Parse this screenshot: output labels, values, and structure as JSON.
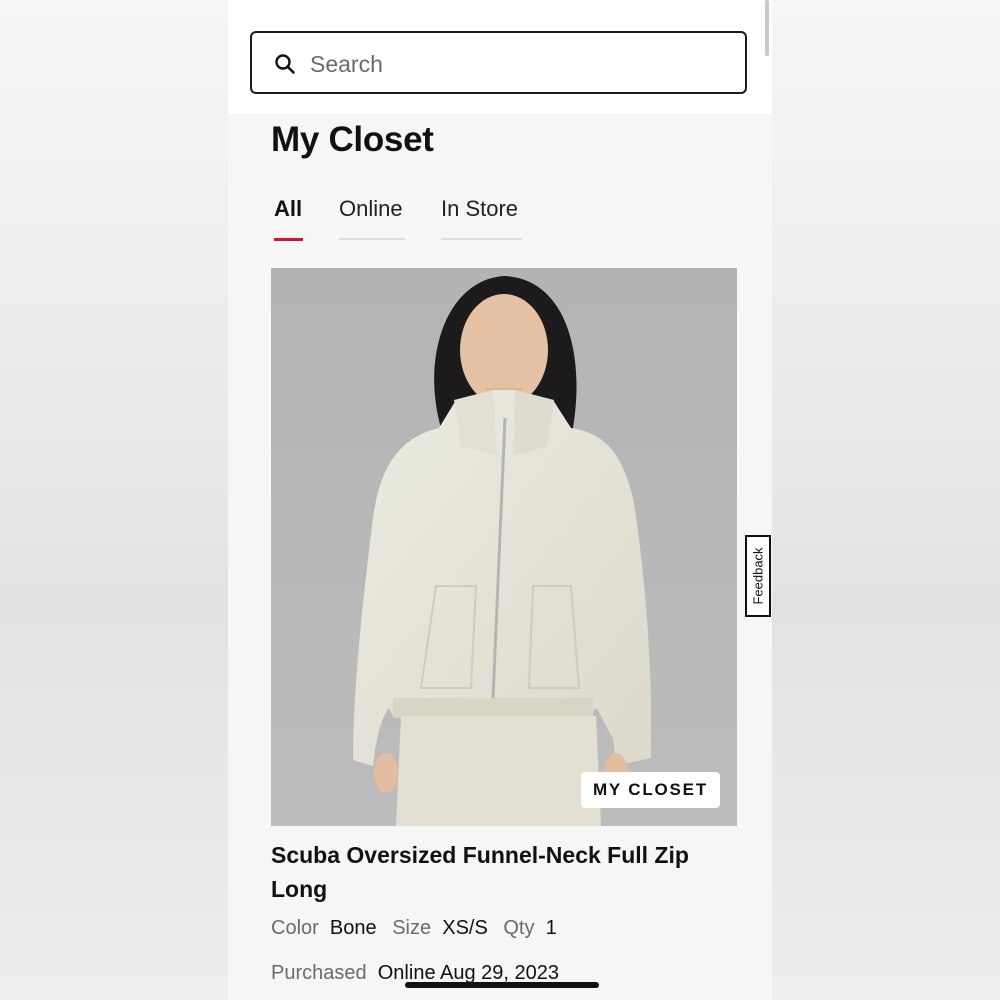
{
  "search": {
    "placeholder": "Search"
  },
  "page": {
    "title": "My Closet"
  },
  "tabs": [
    {
      "label": "All",
      "active": true
    },
    {
      "label": "Online",
      "active": false
    },
    {
      "label": "In Store",
      "active": false
    }
  ],
  "product": {
    "badge": "MY CLOSET",
    "name": "Scuba Oversized Funnel-Neck Full Zip Long",
    "color_label": "Color",
    "color_value": "Bone",
    "size_label": "Size",
    "size_value": "XS/S",
    "qty_label": "Qty",
    "qty_value": "1",
    "purchased_label": "Purchased",
    "purchased_value": "Online Aug 29, 2023"
  },
  "feedback": {
    "label": "Feedback"
  },
  "icons": {
    "search": "search-icon"
  },
  "colors": {
    "accent": "#d31334",
    "text": "#111111",
    "muted": "#6b6b6b",
    "background": "#f6f6f7"
  }
}
